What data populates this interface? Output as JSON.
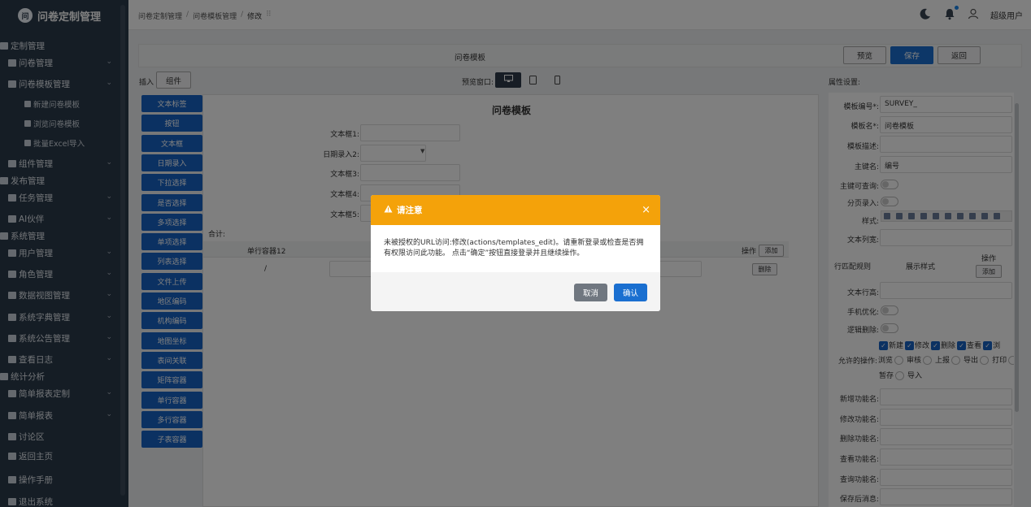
{
  "app": {
    "logo_text": "问",
    "title": "问卷定制管理"
  },
  "sidebar": [
    {
      "label": "定制管理",
      "kind": "section",
      "icon": "folder-icon"
    },
    {
      "label": "问卷管理",
      "kind": "menu",
      "icon": "grid-icon",
      "chev": "⌄"
    },
    {
      "label": "问卷模板管理",
      "kind": "menu",
      "icon": "table-icon",
      "chev": "⌄"
    },
    {
      "label": "新建问卷模板",
      "kind": "sub",
      "icon": "plus-square-icon"
    },
    {
      "label": "浏览问卷模板",
      "kind": "sub",
      "icon": "list-icon"
    },
    {
      "label": "批量Excel导入",
      "kind": "sub",
      "icon": "plus-square-icon"
    },
    {
      "label": "组件管理",
      "kind": "menu",
      "icon": "puzzle-icon",
      "chev": "⌄"
    },
    {
      "label": "发布管理",
      "kind": "section",
      "icon": "folder-icon"
    },
    {
      "label": "任务管理",
      "kind": "menu",
      "icon": "task-icon",
      "chev": "⌄"
    },
    {
      "label": "AI伙伴",
      "kind": "menu",
      "icon": "robot-icon",
      "chev": "⌄"
    },
    {
      "label": "系统管理",
      "kind": "section",
      "icon": "users-icon"
    },
    {
      "label": "用户管理",
      "kind": "menu",
      "icon": "user-group-icon",
      "chev": "⌄"
    },
    {
      "label": "角色管理",
      "kind": "menu",
      "icon": "role-icon",
      "chev": "⌄"
    },
    {
      "label": "数据视图管理",
      "kind": "menu",
      "icon": "data-view-icon",
      "chev": "⌄"
    },
    {
      "label": "系统字典管理",
      "kind": "menu",
      "icon": "dictionary-icon",
      "chev": "⌄"
    },
    {
      "label": "系统公告管理",
      "kind": "menu",
      "icon": "keyboard-icon",
      "chev": "⌄"
    },
    {
      "label": "查看日志",
      "kind": "menu",
      "icon": "log-icon",
      "chev": "⌄"
    },
    {
      "label": "统计分析",
      "kind": "section",
      "icon": "pie-icon"
    },
    {
      "label": "简单报表定制",
      "kind": "menu",
      "icon": "pie-icon",
      "chev": "⌄"
    },
    {
      "label": "简单报表",
      "kind": "menu",
      "icon": "pie-icon",
      "chev": "⌄"
    },
    {
      "label": "讨论区",
      "kind": "menu",
      "icon": "discussion-icon"
    },
    {
      "label": "返回主页",
      "kind": "menu",
      "icon": "home-icon"
    },
    {
      "label": "操作手册",
      "kind": "menu",
      "icon": "help-icon"
    },
    {
      "label": "退出系统",
      "kind": "menu",
      "icon": "logout-icon"
    }
  ],
  "breadcrumb": {
    "a": "问卷定制管理",
    "b": "问卷模板管理",
    "c": "修改",
    "sep": "/"
  },
  "topbar": {
    "user": "超级用户"
  },
  "editor": {
    "title": "问卷模板",
    "preview": "预览",
    "save": "保存",
    "back": "返回",
    "insert_label": "插入",
    "component_btn": "组件",
    "preview_window": "预览窗口:",
    "property_settings": "属性设置:"
  },
  "components": [
    "文本标签",
    "按钮",
    "文本框",
    "日期录入",
    "下拉选择",
    "是否选择",
    "多项选择",
    "单项选择",
    "列表选择",
    "文件上传",
    "地区编码",
    "机构编码",
    "地图坐标",
    "表间关联",
    "矩阵容器",
    "单行容器",
    "多行容器",
    "子表容器"
  ],
  "canvas": {
    "title": "问卷模板",
    "fields": [
      "文本框1:",
      "日期录入2:",
      "文本框3:",
      "文本框4:",
      "文本框5:"
    ],
    "sum_label": "合计:",
    "table_header": "单行容器12",
    "ops_label": "操作",
    "add": "添加",
    "row_cell": "/",
    "delete": "删除"
  },
  "properties": {
    "template_no_label": "模板编号*:",
    "template_no": "SURVEY_",
    "template_name_label": "模板名*:",
    "template_name": "问卷模板",
    "desc_label": "模板描述:",
    "pk_label": "主键名:",
    "pk": "编号",
    "pk_query_label": "主键可查询:",
    "page_input_label": "分页录入:",
    "style_label": "样式:",
    "col_width_label": "文本列宽:",
    "match_rule": "行匹配规则",
    "display_style": "展示样式",
    "ops": "操作",
    "add": "添加",
    "row_height_label": "文本行高:",
    "mobile_label": "手机优化:",
    "logic_delete_label": "逻辑删除:",
    "perm_checks": [
      "新建",
      "修改",
      "删除",
      "查看",
      "浏"
    ],
    "allowed_ops_label": "允许的操作:",
    "radios1": [
      "浏览",
      "审核",
      "上报",
      "导出",
      "打印"
    ],
    "radios2": [
      "暂存",
      "导入"
    ],
    "new_fn_label": "新增功能名:",
    "edit_fn_label": "修改功能名:",
    "del_fn_label": "删除功能名:",
    "view_fn_label": "查看功能名:",
    "query_fn_label": "查询功能名:",
    "after_save_label": "保存后消息:"
  },
  "dialog": {
    "title": "请注意",
    "message": "未被授权的URL访问:修改(actions/templates_edit)。请重新登录或检查是否拥有权限访问此功能。 点击“确定”按钮直接登录并且继续操作。",
    "cancel": "取消",
    "confirm": "确认",
    "close": "×"
  },
  "colors": {
    "sidebar_bg": "#2b3a4a",
    "primary": "#1762c4",
    "warning": "#f4a20a"
  }
}
